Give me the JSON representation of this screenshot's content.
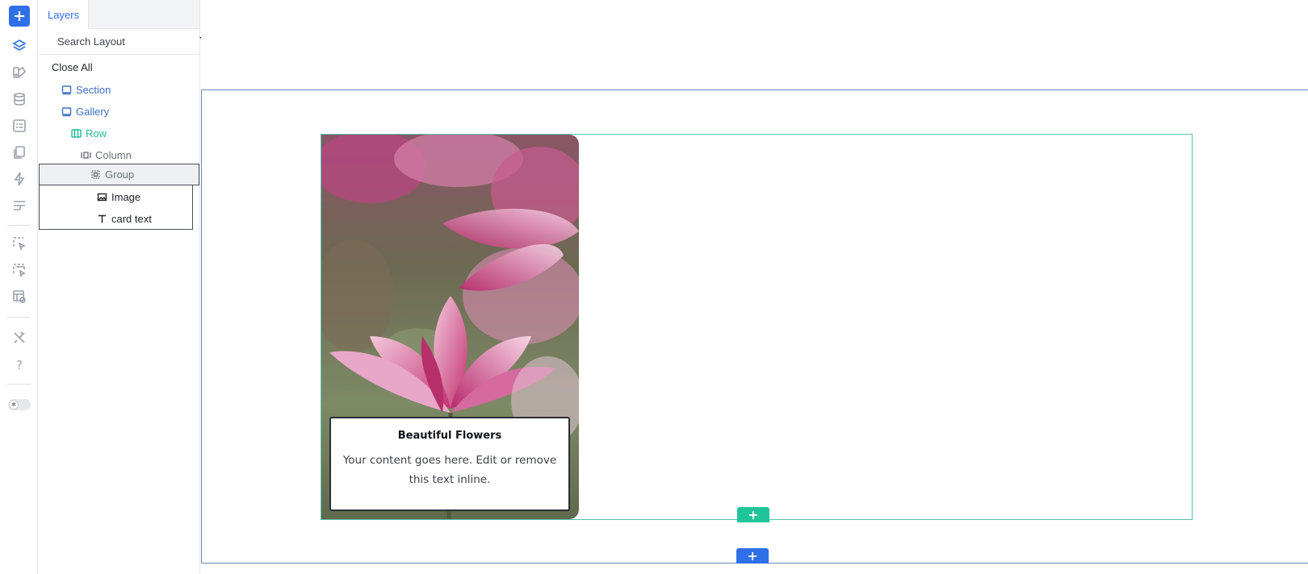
{
  "sidebar": {
    "icons": [
      "plus-icon",
      "layers-icon",
      "paint-icon",
      "database-icon",
      "form-icon",
      "pages-icon",
      "bolt-icon",
      "table-icon",
      "select-icon",
      "multi-select-icon",
      "preview-icon",
      "tools-icon",
      "help-icon",
      "toggle-icon"
    ],
    "help_label": "?"
  },
  "panel": {
    "tab_label": "Layers",
    "search_placeholder": "Search Layout",
    "close_all": "Close All",
    "tree": [
      {
        "label": "Section",
        "icon": "section-icon",
        "color": "#3b6fc4"
      },
      {
        "label": "Gallery",
        "icon": "section-icon",
        "color": "#3b6fc4"
      },
      {
        "label": "Row",
        "icon": "row-icon",
        "color": "#22b89a"
      },
      {
        "label": "Column",
        "icon": "column-icon",
        "color": "#6b717b"
      },
      {
        "label": "Group",
        "icon": "group-icon",
        "color": "#6b717b",
        "selected": true
      },
      {
        "label": "Image",
        "icon": "image-icon",
        "color": "#1f2329"
      },
      {
        "label": "card text",
        "icon": "text-icon",
        "color": "#1f2329"
      }
    ]
  },
  "canvas": {
    "card": {
      "title": "Beautiful Flowers",
      "body": "Your content goes here. Edit or remove this text inline."
    },
    "colors": {
      "section_border": "#6c86b2",
      "row_border": "#56c2ad",
      "add_row": "#1fc49a",
      "add_section": "#2f6fe8"
    }
  }
}
